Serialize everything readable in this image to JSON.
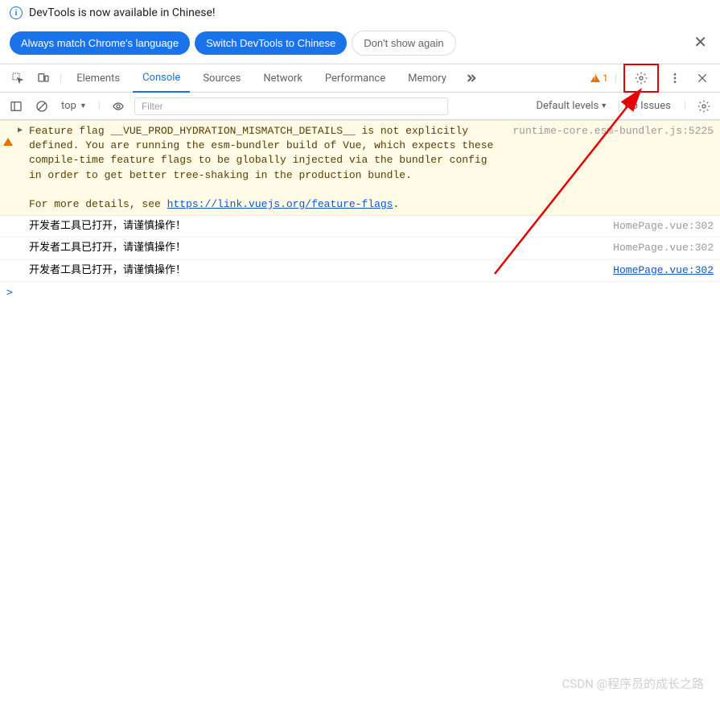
{
  "info_bar": {
    "text": "DevTools is now available in Chinese!"
  },
  "buttons": {
    "always_match": "Always match Chrome's language",
    "switch": "Switch DevTools to Chinese",
    "dont_show": "Don't show again"
  },
  "tabs": {
    "elements": "Elements",
    "console": "Console",
    "sources": "Sources",
    "network": "Network",
    "performance": "Performance",
    "memory": "Memory"
  },
  "warning_count": "1",
  "console_toolbar": {
    "context": "top",
    "filter_placeholder": "Filter",
    "levels": "Default levels",
    "issues": "No Issues"
  },
  "logs": {
    "warning_msg": "Feature flag __VUE_PROD_HYDRATION_MISMATCH_DETAILS__ is not explicitly defined. You are running the esm-bundler build of Vue, which expects these compile-time feature flags to be globally injected via the bundler config in order to get better tree-shaking in the production bundle.",
    "warning_more": "For more details, see ",
    "warning_link": "https://link.vuejs.org/feature-flags",
    "warning_src": "runtime-core.esm-bundler.js:5225",
    "rows": [
      {
        "msg": "开发者工具已打开，请谨慎操作！",
        "src": "HomePage.vue:302",
        "link": false
      },
      {
        "msg": "开发者工具已打开，请谨慎操作！",
        "src": "HomePage.vue:302",
        "link": false
      },
      {
        "msg": "开发者工具已打开，请谨慎操作！",
        "src": "HomePage.vue:302",
        "link": true
      }
    ]
  },
  "prompt": ">",
  "watermark": "CSDN @程序员的成长之路"
}
